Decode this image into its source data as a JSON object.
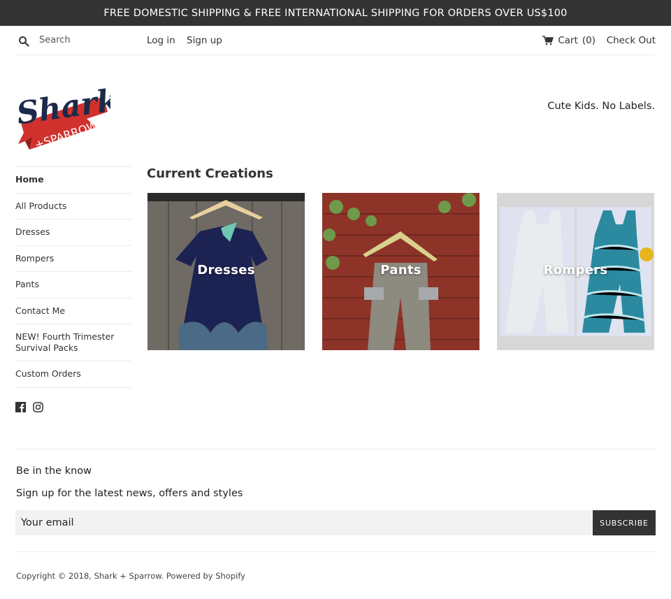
{
  "announcement": "FREE DOMESTIC SHIPPING & FREE INTERNATIONAL SHIPPING FOR ORDERS OVER US$100",
  "header": {
    "search_placeholder": "Search",
    "login": "Log in",
    "signup": "Sign up",
    "cart_label": "Cart",
    "cart_count": "(0)",
    "checkout": "Check Out",
    "icons": {
      "search": "search-icon",
      "cart": "cart-icon"
    }
  },
  "brand": {
    "logo_text_top": "Shark",
    "logo_text_bottom": "+SPARROW",
    "tagline": "Cute Kids. No Labels.",
    "colors": {
      "navy": "#1b2a4a",
      "red": "#d0312d"
    }
  },
  "sidebar": {
    "items": [
      {
        "label": "Home",
        "active": true
      },
      {
        "label": "All Products"
      },
      {
        "label": "Dresses"
      },
      {
        "label": "Rompers"
      },
      {
        "label": "Pants"
      },
      {
        "label": "Contact Me"
      },
      {
        "label": "NEW! Fourth Trimester Survival Packs"
      },
      {
        "label": "Custom Orders"
      }
    ],
    "social": [
      "facebook-icon",
      "instagram-icon"
    ]
  },
  "main": {
    "title": "Current Creations",
    "collections": [
      {
        "label": "Dresses"
      },
      {
        "label": "Pants"
      },
      {
        "label": "Rompers"
      }
    ]
  },
  "newsletter": {
    "title": "Be in the know",
    "subtitle": "Sign up for the latest news, offers and styles",
    "email_placeholder": "Your email",
    "button": "SUBSCRIBE"
  },
  "footer": {
    "copyright": "Copyright © 2018, Shark + Sparrow.",
    "powered": "Powered by Shopify"
  },
  "colors": {
    "dark": "#333333",
    "rule": "#ebebeb",
    "input_bg": "#f2f2f2"
  }
}
